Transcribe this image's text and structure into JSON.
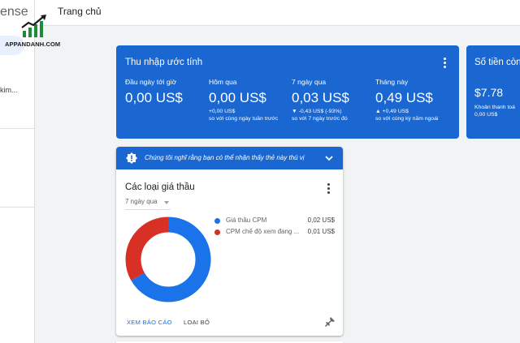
{
  "app": {
    "brand_fragment": "ense"
  },
  "sidebar": {
    "truncated_item": "kim..."
  },
  "topbar": {
    "title": "Trang chủ"
  },
  "watermark": {
    "text": "APPANDANH.COM"
  },
  "earnings": {
    "title": "Thu nhập ước tính",
    "metrics": [
      {
        "label": "Đầu ngày tới giờ",
        "value": "0,00 US$",
        "delta": "",
        "compare": ""
      },
      {
        "label": "Hôm qua",
        "value": "0,00 US$",
        "delta": "+0,00 US$",
        "compare": "so với cùng ngày tuần trước"
      },
      {
        "label": "7 ngày qua",
        "value": "0,03 US$",
        "delta": "▼ -0,43 US$ (-93%)",
        "compare": "so với 7 ngày trước đó"
      },
      {
        "label": "Tháng này",
        "value": "0,49 US$",
        "delta": "▲ +0,49 US$",
        "compare": "so với cùng kỳ năm ngoái"
      }
    ]
  },
  "balance": {
    "title": "Số tiền còn",
    "value": "$7.78",
    "sub": "Khoản thanh toá",
    "sub2": "0,00 US$"
  },
  "bidders": {
    "banner_text": "Chúng tôi nghĩ rằng bạn có thể nhận thấy thẻ này thú vị",
    "title": "Các loại giá thầu",
    "range": "7 ngày qua",
    "report_button": "XEM BÁO CÁO",
    "dismiss_button": "LOẠI BỎ"
  },
  "chart_data": {
    "type": "pie",
    "categories": [
      "Giá thầu CPM",
      "CPM chế độ xem đang ..."
    ],
    "values": [
      0.02,
      0.01
    ],
    "value_labels": [
      "0,02 US$",
      "0,01 US$"
    ],
    "colors": [
      "#1a73e8",
      "#d93025"
    ],
    "style": "donut",
    "legend_position": "right"
  }
}
